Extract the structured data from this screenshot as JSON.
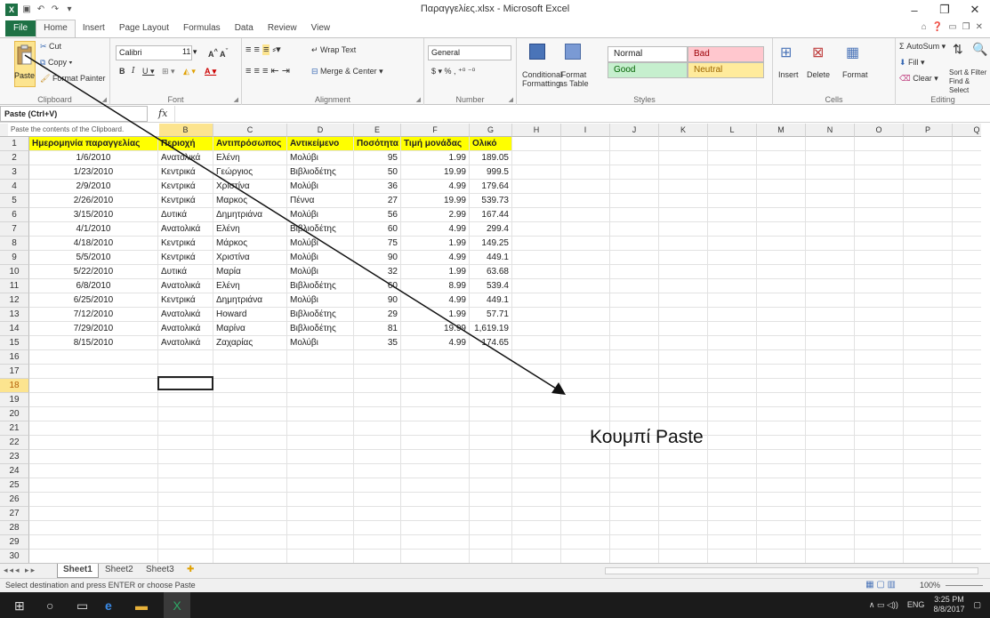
{
  "window": {
    "title": "Παραγγελίες.xlsx - Microsoft Excel",
    "minimize": "–",
    "restore": "❐",
    "close": "✕"
  },
  "tabs": [
    "File",
    "Home",
    "Insert",
    "Page Layout",
    "Formulas",
    "Data",
    "Review",
    "View"
  ],
  "ribbon": {
    "clipboard": {
      "paste": "Paste",
      "cut": "Cut",
      "copy": "Copy",
      "format_painter": "Format Painter",
      "label": "Clipboard"
    },
    "font": {
      "name": "Calibri",
      "size": "11",
      "label": "Font"
    },
    "alignment": {
      "wrap": "Wrap Text",
      "merge": "Merge & Center",
      "label": "Alignment"
    },
    "number": {
      "format": "General",
      "label": "Number"
    },
    "styles": {
      "conditional": "Conditional Formatting",
      "format_table": "Format as Table",
      "normal": "Normal",
      "bad": "Bad",
      "good": "Good",
      "neutral": "Neutral",
      "label": "Styles"
    },
    "cells": {
      "insert": "Insert",
      "delete": "Delete",
      "format": "Format",
      "label": "Cells"
    },
    "editing": {
      "autosum": "AutoSum",
      "fill": "Fill",
      "clear": "Clear",
      "sort": "Sort & Filter",
      "find": "Find & Select",
      "label": "Editing"
    }
  },
  "formula_bar": {
    "namebox": "Paste (Ctrl+V)",
    "fx": "fx",
    "tooltip": "Paste the contents of the Clipboard."
  },
  "columns": [
    "A",
    "B",
    "C",
    "D",
    "E",
    "F",
    "G",
    "H",
    "I",
    "J",
    "K",
    "L",
    "M",
    "N",
    "O",
    "P",
    "Q"
  ],
  "header_row": [
    "Ημερομηνία παραγγελίας",
    "Περιοχή",
    "Αντιπρόσωπος",
    "Αντικείμενο",
    "Ποσότητα",
    "Τιμή μονάδας",
    "Ολικό"
  ],
  "rows": [
    [
      "1/6/2010",
      "Ανατολικά",
      "Ελένη",
      "Μολύβι",
      "95",
      "1.99",
      "189.05"
    ],
    [
      "1/23/2010",
      "Κεντρικά",
      "Γεώργιος",
      "Βιβλιοδέτης",
      "50",
      "19.99",
      "999.5"
    ],
    [
      "2/9/2010",
      "Κεντρικά",
      "Χριστίνα",
      "Μολύβι",
      "36",
      "4.99",
      "179.64"
    ],
    [
      "2/26/2010",
      "Κεντρικά",
      "Μαρκος",
      "Πέννα",
      "27",
      "19.99",
      "539.73"
    ],
    [
      "3/15/2010",
      "Δυτικά",
      "Δημητριάνα",
      "Μολύβι",
      "56",
      "2.99",
      "167.44"
    ],
    [
      "4/1/2010",
      "Ανατολικά",
      "Ελένη",
      "Βιβλιοδέτης",
      "60",
      "4.99",
      "299.4"
    ],
    [
      "4/18/2010",
      "Κεντρικά",
      "Μάρκος",
      "Μολύβι",
      "75",
      "1.99",
      "149.25"
    ],
    [
      "5/5/2010",
      "Κεντρικά",
      "Χριστίνα",
      "Μολύβι",
      "90",
      "4.99",
      "449.1"
    ],
    [
      "5/22/2010",
      "Δυτικά",
      "Μαρία",
      "Μολύβι",
      "32",
      "1.99",
      "63.68"
    ],
    [
      "6/8/2010",
      "Ανατολικά",
      "Ελένη",
      "Βιβλιοδέτης",
      "60",
      "8.99",
      "539.4"
    ],
    [
      "6/25/2010",
      "Κεντρικά",
      "Δημητριάνα",
      "Μολύβι",
      "90",
      "4.99",
      "449.1"
    ],
    [
      "7/12/2010",
      "Ανατολικά",
      "Howard",
      "Βιβλιοδέτης",
      "29",
      "1.99",
      "57.71"
    ],
    [
      "7/29/2010",
      "Ανατολικά",
      "Μαρίνα",
      "Βιβλιοδέτης",
      "81",
      "19.99",
      "1,619.19"
    ],
    [
      "8/15/2010",
      "Ανατολικά",
      "Ζαχαρίας",
      "Μολύβι",
      "35",
      "4.99",
      "174.65"
    ]
  ],
  "row_numbers": [
    "1",
    "2",
    "3",
    "4",
    "5",
    "6",
    "7",
    "8",
    "9",
    "10",
    "11",
    "12",
    "13",
    "14",
    "15",
    "16",
    "17",
    "18",
    "19",
    "20",
    "21",
    "22",
    "23",
    "24",
    "25",
    "26",
    "27",
    "28",
    "29",
    "30"
  ],
  "selected_row": "18",
  "selected_col": "B",
  "sheets": [
    "Sheet1",
    "Sheet2",
    "Sheet3"
  ],
  "status": {
    "text": "Select destination and press ENTER or choose Paste",
    "zoom": "100%"
  },
  "taskbar": {
    "lang": "ENG",
    "time": "3:25 PM",
    "date": "8/8/2017"
  },
  "annotation": {
    "label": "Κουμπί Paste"
  },
  "colors": {
    "excel_green": "#1e7145",
    "header_yellow": "#ffff00",
    "bad": "#ffc7ce",
    "good": "#c6efce",
    "neutral": "#ffeb9c"
  }
}
